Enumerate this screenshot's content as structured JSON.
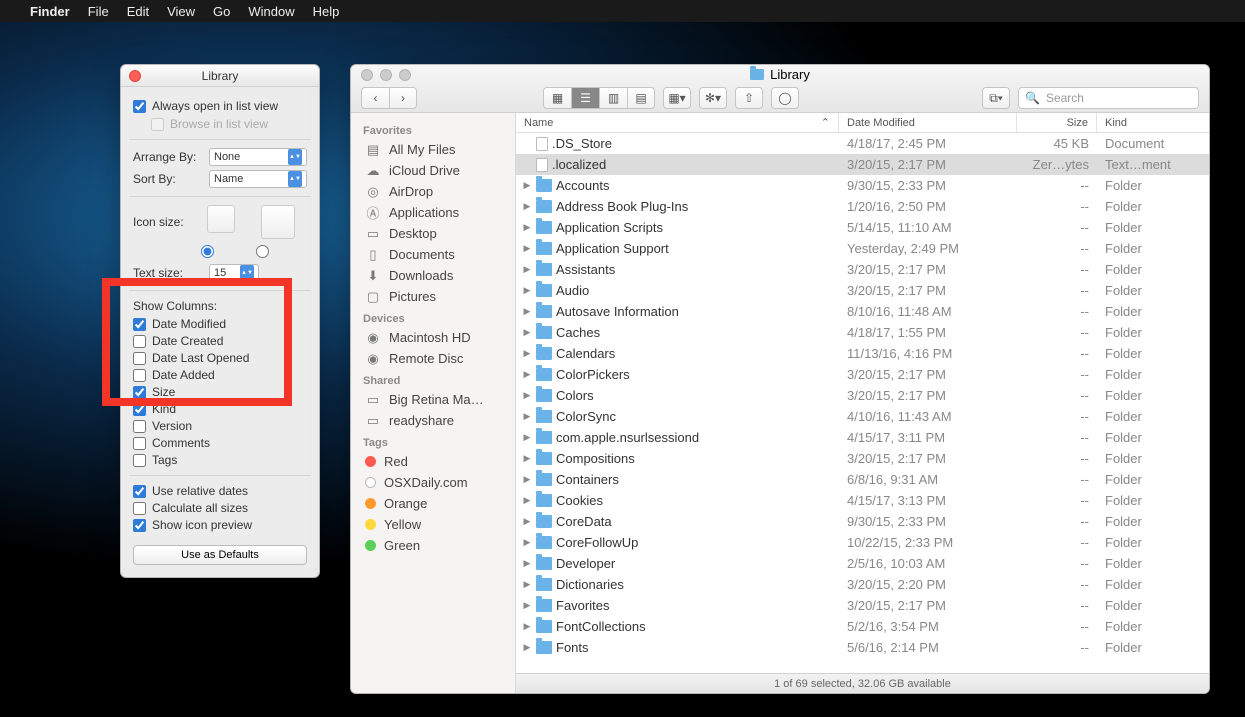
{
  "menubar": {
    "app": "Finder",
    "items": [
      "File",
      "Edit",
      "View",
      "Go",
      "Window",
      "Help"
    ]
  },
  "viewopts": {
    "title": "Library",
    "always_open": "Always open in list view",
    "browse": "Browse in list view",
    "arrange_label": "Arrange By:",
    "arrange_value": "None",
    "sort_label": "Sort By:",
    "sort_value": "Name",
    "icon_size_label": "Icon size:",
    "text_size_label": "Text size:",
    "text_size_value": "15",
    "show_columns": "Show Columns:",
    "col_date_modified": "Date Modified",
    "col_date_created": "Date Created",
    "col_date_last_opened": "Date Last Opened",
    "col_date_added": "Date Added",
    "col_size": "Size",
    "col_kind": "Kind",
    "col_version": "Version",
    "col_comments": "Comments",
    "col_tags": "Tags",
    "use_relative": "Use relative dates",
    "calc_sizes": "Calculate all sizes",
    "show_preview": "Show icon preview",
    "defaults_btn": "Use as Defaults"
  },
  "finder": {
    "title": "Library",
    "search_placeholder": "Search",
    "sidebar": {
      "favorites_label": "Favorites",
      "favorites": [
        "All My Files",
        "iCloud Drive",
        "AirDrop",
        "Applications",
        "Desktop",
        "Documents",
        "Downloads",
        "Pictures"
      ],
      "devices_label": "Devices",
      "devices": [
        "Macintosh HD",
        "Remote Disc"
      ],
      "shared_label": "Shared",
      "shared": [
        "Big Retina Ma…",
        "readyshare"
      ],
      "tags_label": "Tags",
      "tags": [
        {
          "name": "Red",
          "color": "#ff5b52"
        },
        {
          "name": "OSXDaily.com",
          "color": "#ffffff"
        },
        {
          "name": "Orange",
          "color": "#ff9a2e"
        },
        {
          "name": "Yellow",
          "color": "#ffd93b"
        },
        {
          "name": "Green",
          "color": "#5ad05a"
        }
      ]
    },
    "columns": {
      "name": "Name",
      "date": "Date Modified",
      "size": "Size",
      "kind": "Kind"
    },
    "rows": [
      {
        "name": ".DS_Store",
        "date": "4/18/17, 2:45 PM",
        "size": "45 KB",
        "kind": "Document",
        "type": "doc",
        "disclose": false,
        "sel": false
      },
      {
        "name": ".localized",
        "date": "3/20/15, 2:17 PM",
        "size": "Zer…ytes",
        "kind": "Text…ment",
        "type": "doc",
        "disclose": false,
        "sel": true
      },
      {
        "name": "Accounts",
        "date": "9/30/15, 2:33 PM",
        "size": "--",
        "kind": "Folder",
        "type": "folder",
        "disclose": true
      },
      {
        "name": "Address Book Plug-Ins",
        "date": "1/20/16, 2:50 PM",
        "size": "--",
        "kind": "Folder",
        "type": "folder",
        "disclose": true
      },
      {
        "name": "Application Scripts",
        "date": "5/14/15, 11:10 AM",
        "size": "--",
        "kind": "Folder",
        "type": "folder",
        "disclose": true
      },
      {
        "name": "Application Support",
        "date": "Yesterday, 2:49 PM",
        "size": "--",
        "kind": "Folder",
        "type": "folder",
        "disclose": true
      },
      {
        "name": "Assistants",
        "date": "3/20/15, 2:17 PM",
        "size": "--",
        "kind": "Folder",
        "type": "folder",
        "disclose": true
      },
      {
        "name": "Audio",
        "date": "3/20/15, 2:17 PM",
        "size": "--",
        "kind": "Folder",
        "type": "folder",
        "disclose": true
      },
      {
        "name": "Autosave Information",
        "date": "8/10/16, 11:48 AM",
        "size": "--",
        "kind": "Folder",
        "type": "folder",
        "disclose": true
      },
      {
        "name": "Caches",
        "date": "4/18/17, 1:55 PM",
        "size": "--",
        "kind": "Folder",
        "type": "folder",
        "disclose": true
      },
      {
        "name": "Calendars",
        "date": "11/13/16, 4:16 PM",
        "size": "--",
        "kind": "Folder",
        "type": "folder",
        "disclose": true
      },
      {
        "name": "ColorPickers",
        "date": "3/20/15, 2:17 PM",
        "size": "--",
        "kind": "Folder",
        "type": "folder",
        "disclose": true
      },
      {
        "name": "Colors",
        "date": "3/20/15, 2:17 PM",
        "size": "--",
        "kind": "Folder",
        "type": "folder",
        "disclose": true
      },
      {
        "name": "ColorSync",
        "date": "4/10/16, 11:43 AM",
        "size": "--",
        "kind": "Folder",
        "type": "folder",
        "disclose": true
      },
      {
        "name": "com.apple.nsurlsessiond",
        "date": "4/15/17, 3:11 PM",
        "size": "--",
        "kind": "Folder",
        "type": "folder",
        "disclose": true
      },
      {
        "name": "Compositions",
        "date": "3/20/15, 2:17 PM",
        "size": "--",
        "kind": "Folder",
        "type": "folder",
        "disclose": true
      },
      {
        "name": "Containers",
        "date": "6/8/16, 9:31 AM",
        "size": "--",
        "kind": "Folder",
        "type": "folder",
        "disclose": true
      },
      {
        "name": "Cookies",
        "date": "4/15/17, 3:13 PM",
        "size": "--",
        "kind": "Folder",
        "type": "folder",
        "disclose": true
      },
      {
        "name": "CoreData",
        "date": "9/30/15, 2:33 PM",
        "size": "--",
        "kind": "Folder",
        "type": "folder",
        "disclose": true
      },
      {
        "name": "CoreFollowUp",
        "date": "10/22/15, 2:33 PM",
        "size": "--",
        "kind": "Folder",
        "type": "folder",
        "disclose": true
      },
      {
        "name": "Developer",
        "date": "2/5/16, 10:03 AM",
        "size": "--",
        "kind": "Folder",
        "type": "folder",
        "disclose": true
      },
      {
        "name": "Dictionaries",
        "date": "3/20/15, 2:20 PM",
        "size": "--",
        "kind": "Folder",
        "type": "folder",
        "disclose": true
      },
      {
        "name": "Favorites",
        "date": "3/20/15, 2:17 PM",
        "size": "--",
        "kind": "Folder",
        "type": "folder",
        "disclose": true
      },
      {
        "name": "FontCollections",
        "date": "5/2/16, 3:54 PM",
        "size": "--",
        "kind": "Folder",
        "type": "folder",
        "disclose": true
      },
      {
        "name": "Fonts",
        "date": "5/6/16, 2:14 PM",
        "size": "--",
        "kind": "Folder",
        "type": "folder",
        "disclose": true
      }
    ],
    "status": "1 of 69 selected, 32.06 GB available"
  }
}
